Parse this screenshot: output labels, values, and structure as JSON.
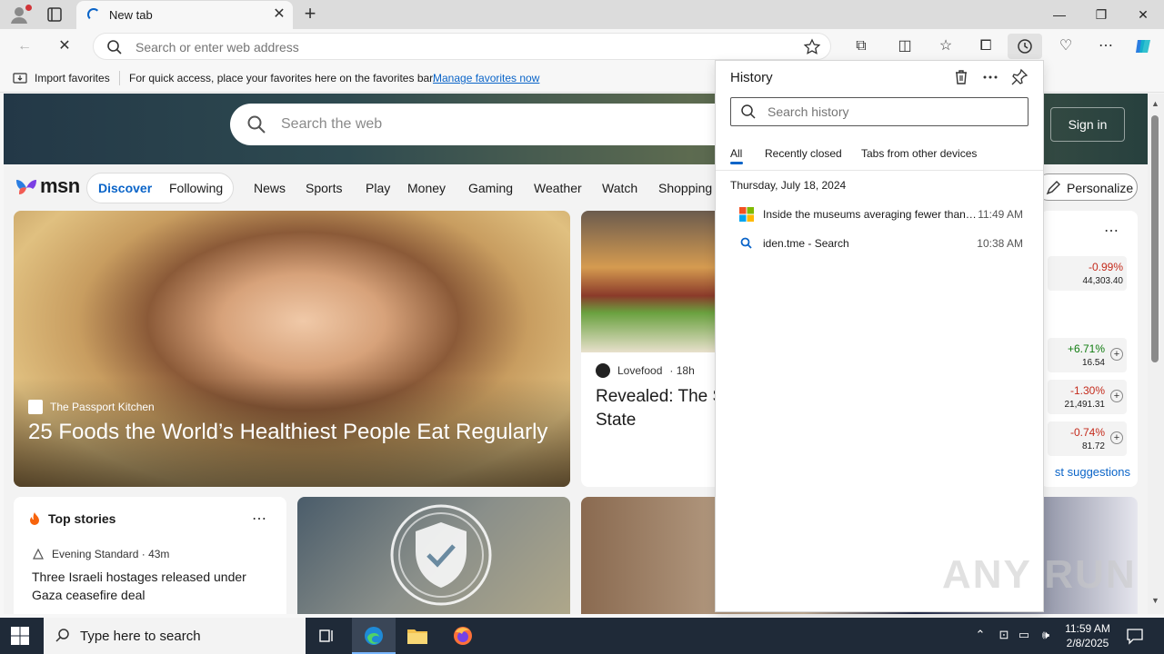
{
  "tab": {
    "title": "New tab"
  },
  "address_bar": {
    "placeholder": "Search or enter web address"
  },
  "favorites_bar": {
    "import_label": "Import favorites",
    "message": "For quick access, place your favorites here on the favorites bar.",
    "manage_link": "Manage favorites now"
  },
  "msn": {
    "search_placeholder": "Search the web",
    "signin_label": "Sign in",
    "logo_text": "msn",
    "pill": {
      "discover": "Discover",
      "following": "Following"
    },
    "nav_items": [
      "News",
      "Sports",
      "Play",
      "Money",
      "Gaming",
      "Weather",
      "Watch",
      "Shopping"
    ],
    "personalize_label": "Personalize",
    "hero": {
      "source": "The Passport Kitchen",
      "title": "25 Foods the World’s Healthiest People Eat Regularly"
    },
    "card2": {
      "source": "Lovefood",
      "time": "· 18h",
      "title": "Revealed: The Sandwich In Ev State"
    },
    "stocks": [
      {
        "pct": "-0.99%",
        "value": "44,303.40",
        "direction": "down"
      },
      {
        "pct": "+6.71%",
        "value": "16.54",
        "direction": "up"
      },
      {
        "pct": "-1.30%",
        "value": "21,491.31",
        "direction": "down"
      },
      {
        "pct": "-0.74%",
        "value": "81.72",
        "direction": "down"
      }
    ],
    "suggestions_link": "st suggestions",
    "top_stories": {
      "heading": "Top stories",
      "source": "Evening Standard · 43m",
      "title": "Three Israeli hostages released under Gaza ceasefire deal"
    }
  },
  "history": {
    "title": "History",
    "search_placeholder": "Search history",
    "tabs": [
      "All",
      "Recently closed",
      "Tabs from other devices"
    ],
    "date": "Thursday, July 18, 2024",
    "items": [
      {
        "title": "Inside the museums averaging fewer than ...",
        "time": "11:49 AM",
        "icon": "microsoft-icon"
      },
      {
        "title": "iden.tme - Search",
        "time": "10:38 AM",
        "icon": "search-icon"
      }
    ]
  },
  "watermark": "ANY RUN",
  "taskbar": {
    "search_placeholder": "Type here to search",
    "time": "11:59 AM",
    "date": "2/8/2025"
  },
  "colors": {
    "accent": "#0a64c8",
    "negative": "#c42b1c",
    "positive": "#107c10",
    "taskbar": "#1f2a38"
  }
}
